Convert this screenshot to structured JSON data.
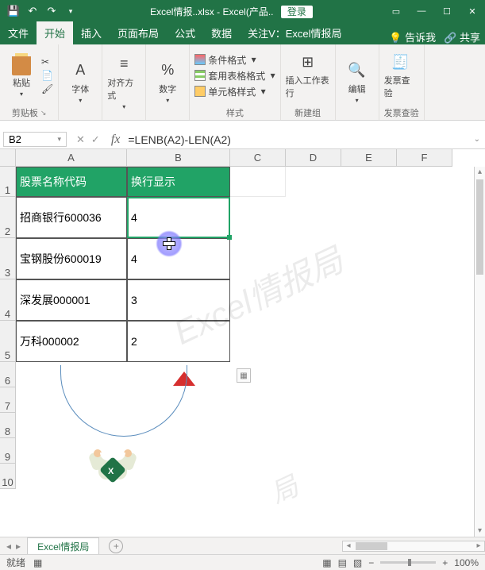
{
  "titlebar": {
    "filename": "Excel情报..xlsx",
    "app": "Excel(产品..",
    "login": "登录"
  },
  "tabs": {
    "file": "文件",
    "home": "开始",
    "insert": "插入",
    "layout": "页面布局",
    "formulas": "公式",
    "data": "数据",
    "follow": "关注V：Excel情报局",
    "tellme": "告诉我",
    "share": "共享"
  },
  "ribbon": {
    "clipboard": {
      "paste": "粘贴",
      "label": "剪贴板"
    },
    "font": {
      "label": "字体"
    },
    "align": {
      "label": "对齐方式"
    },
    "number": {
      "label": "数字"
    },
    "styles": {
      "cond": "条件格式",
      "fmt": "套用表格格式",
      "cell": "单元格样式",
      "label": "样式"
    },
    "newgroup": {
      "insert": "插入工作表行",
      "label": "新建组"
    },
    "edit": {
      "label": "编辑"
    },
    "invoice": {
      "btn": "发票查验",
      "label": "发票查验"
    }
  },
  "namebox": "B2",
  "formula": "=LENB(A2)-LEN(A2)",
  "cols": [
    "A",
    "B",
    "C",
    "D",
    "E",
    "F"
  ],
  "rows": [
    "1",
    "2",
    "3",
    "4",
    "5",
    "6",
    "7",
    "8",
    "9",
    "10"
  ],
  "table": {
    "h1": "股票名称代码",
    "h2": "换行显示",
    "r1a": "招商银行600036",
    "r1b": "4",
    "r2a": "宝钢股份600019",
    "r2b": "4",
    "r3a": "深发展000001",
    "r3b": "3",
    "r4a": "万科000002",
    "r4b": "2"
  },
  "watermark1": "Excel情报局",
  "watermark2": "局",
  "sheet_tab": "Excel情报局",
  "status": {
    "ready": "就绪",
    "zoom": "100%"
  },
  "chart_data": {
    "type": "table",
    "columns": [
      "股票名称代码",
      "换行显示"
    ],
    "rows": [
      [
        "招商银行600036",
        4
      ],
      [
        "宝钢股份600019",
        4
      ],
      [
        "深发展000001",
        3
      ],
      [
        "万科000002",
        2
      ]
    ],
    "formula_B2": "=LENB(A2)-LEN(A2)"
  }
}
